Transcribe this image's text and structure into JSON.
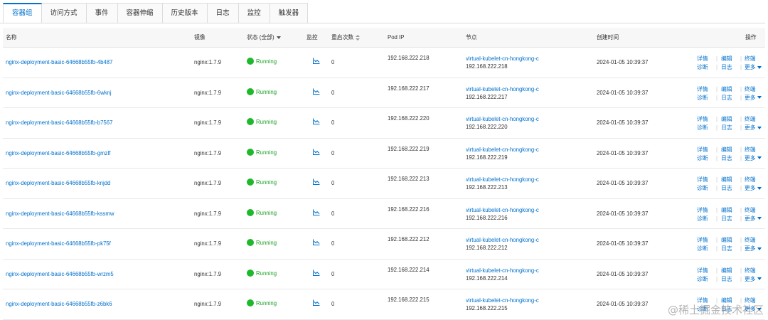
{
  "tabs": [
    "容器组",
    "访问方式",
    "事件",
    "容器伸缩",
    "历史版本",
    "日志",
    "监控",
    "触发器"
  ],
  "active_tab": 0,
  "columns": {
    "name": "名称",
    "image": "镜像",
    "status": "状态 (全部)",
    "monitor": "监控",
    "restarts": "重启次数",
    "pod_ip": "Pod IP",
    "node": "节点",
    "created": "创建时间",
    "actions": "操作"
  },
  "actions": {
    "detail": "详情",
    "edit": "编辑",
    "terminal": "终端",
    "diagnose": "诊断",
    "log": "日志",
    "more": "更多"
  },
  "status_color": "#1fb82d",
  "link_color": "#0070cc",
  "rows": [
    {
      "name": "nginx-deployment-basic-64668b55fb-4b487",
      "image": "nginx:1.7.9",
      "status": "Running",
      "restarts": "0",
      "pod_ip": "192.168.222.218",
      "node_name": "virtual-kubelet-cn-hongkong-c",
      "node_ip": "192.168.222.218",
      "created": "2024-01-05 10:39:37"
    },
    {
      "name": "nginx-deployment-basic-64668b55fb-6wknj",
      "image": "nginx:1.7.9",
      "status": "Running",
      "restarts": "0",
      "pod_ip": "192.168.222.217",
      "node_name": "virtual-kubelet-cn-hongkong-c",
      "node_ip": "192.168.222.217",
      "created": "2024-01-05 10:39:37"
    },
    {
      "name": "nginx-deployment-basic-64668b55fb-b7567",
      "image": "nginx:1.7.9",
      "status": "Running",
      "restarts": "0",
      "pod_ip": "192.168.222.220",
      "node_name": "virtual-kubelet-cn-hongkong-c",
      "node_ip": "192.168.222.220",
      "created": "2024-01-05 10:39:37"
    },
    {
      "name": "nginx-deployment-basic-64668b55fb-gmzlf",
      "image": "nginx:1.7.9",
      "status": "Running",
      "restarts": "0",
      "pod_ip": "192.168.222.219",
      "node_name": "virtual-kubelet-cn-hongkong-c",
      "node_ip": "192.168.222.219",
      "created": "2024-01-05 10:39:37"
    },
    {
      "name": "nginx-deployment-basic-64668b55fb-knjdd",
      "image": "nginx:1.7.9",
      "status": "Running",
      "restarts": "0",
      "pod_ip": "192.168.222.213",
      "node_name": "virtual-kubelet-cn-hongkong-c",
      "node_ip": "192.168.222.213",
      "created": "2024-01-05 10:39:37"
    },
    {
      "name": "nginx-deployment-basic-64668b55fb-kssmw",
      "image": "nginx:1.7.9",
      "status": "Running",
      "restarts": "0",
      "pod_ip": "192.168.222.216",
      "node_name": "virtual-kubelet-cn-hongkong-c",
      "node_ip": "192.168.222.216",
      "created": "2024-01-05 10:39:37"
    },
    {
      "name": "nginx-deployment-basic-64668b55fb-pk75f",
      "image": "nginx:1.7.9",
      "status": "Running",
      "restarts": "0",
      "pod_ip": "192.168.222.212",
      "node_name": "virtual-kubelet-cn-hongkong-c",
      "node_ip": "192.168.222.212",
      "created": "2024-01-05 10:39:37"
    },
    {
      "name": "nginx-deployment-basic-64668b55fb-wrzm5",
      "image": "nginx:1.7.9",
      "status": "Running",
      "restarts": "0",
      "pod_ip": "192.168.222.214",
      "node_name": "virtual-kubelet-cn-hongkong-c",
      "node_ip": "192.168.222.214",
      "created": "2024-01-05 10:39:37"
    },
    {
      "name": "nginx-deployment-basic-64668b55fb-z6bk6",
      "image": "nginx:1.7.9",
      "status": "Running",
      "restarts": "0",
      "pod_ip": "192.168.222.215",
      "node_name": "virtual-kubelet-cn-hongkong-c",
      "node_ip": "192.168.222.215",
      "created": "2024-01-05 10:39:37"
    }
  ],
  "watermark": "@稀土掘金技术社区"
}
